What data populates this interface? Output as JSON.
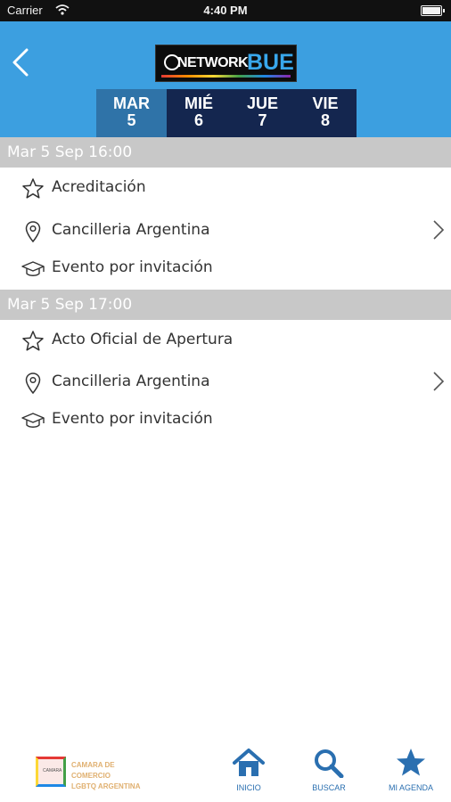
{
  "status_bar": {
    "carrier": "Carrier",
    "time": "4:40 PM"
  },
  "header": {
    "logo": {
      "prefix": "NETWORK",
      "suffix": "BUE"
    },
    "days": [
      {
        "weekday": "MAR",
        "day": "5"
      },
      {
        "weekday": "MIÉ",
        "day": "6"
      },
      {
        "weekday": "JUE",
        "day": "7"
      },
      {
        "weekday": "VIE",
        "day": "8"
      }
    ]
  },
  "sessions": [
    {
      "datetime": "Mar 5 Sep 16:00",
      "title": "Acreditación",
      "location": "Cancilleria Argentina",
      "type": "Evento por invitación"
    },
    {
      "datetime": "Mar 5 Sep 17:00",
      "title": "Acto Oficial de Apertura",
      "location": "Cancilleria Argentina",
      "type": "Evento por invitación"
    }
  ],
  "footer": {
    "sponsor": {
      "mark": "CAMARA",
      "line1": "CAMARA DE COMERCIO",
      "line2": "LGBTQ ARGENTINA"
    },
    "nav": [
      {
        "label": "INICIO",
        "icon": "home-icon"
      },
      {
        "label": "BUSCAR",
        "icon": "search-icon"
      },
      {
        "label": "MI AGENDA",
        "icon": "star-icon"
      }
    ]
  },
  "colors": {
    "header_bg": "#3c9fe0",
    "tabs_bg": "#14264f",
    "tab_active": "#2f73a8",
    "section_bg": "#c8c8c8",
    "nav_accent": "#2a6fb0"
  }
}
